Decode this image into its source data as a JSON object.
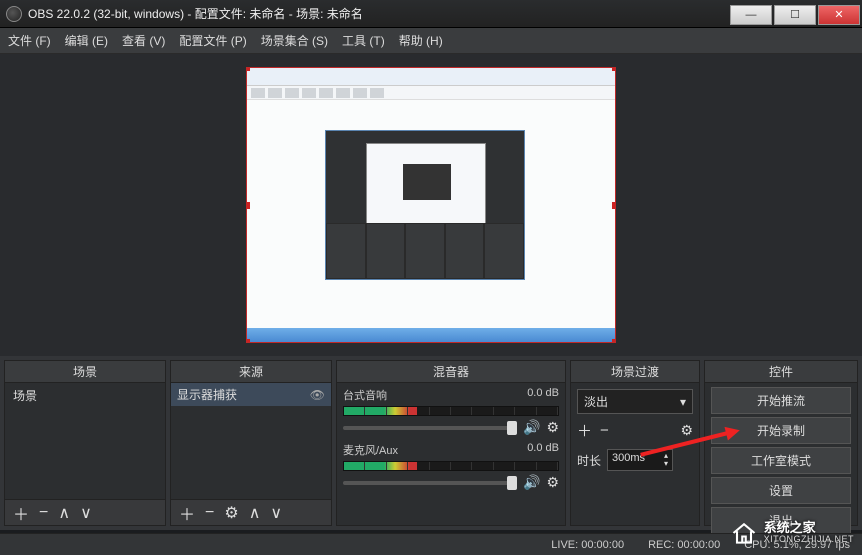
{
  "window": {
    "title": "OBS 22.0.2 (32-bit, windows) - 配置文件: 未命名 - 场景: 未命名"
  },
  "menu": {
    "file": "文件 (F)",
    "edit": "编辑 (E)",
    "view": "查看 (V)",
    "profile": "配置文件 (P)",
    "scene_collection": "场景集合 (S)",
    "tools": "工具 (T)",
    "help": "帮助 (H)"
  },
  "panels": {
    "scenes": {
      "title": "场景",
      "items": [
        "场景"
      ]
    },
    "sources": {
      "title": "来源",
      "items": [
        "显示器捕获"
      ]
    },
    "mixer": {
      "title": "混音器",
      "channels": [
        {
          "name": "台式音响",
          "level": "0.0 dB"
        },
        {
          "name": "麦克风/Aux",
          "level": "0.0 dB"
        }
      ]
    },
    "transitions": {
      "title": "场景过渡",
      "selected": "淡出",
      "duration_label": "时长",
      "duration_value": "300ms"
    },
    "controls": {
      "title": "控件",
      "buttons": {
        "start_stream": "开始推流",
        "start_record": "开始录制",
        "studio_mode": "工作室模式",
        "settings": "设置",
        "exit": "退出"
      }
    }
  },
  "statusbar": {
    "live": "LIVE: 00:00:00",
    "rec": "REC: 00:00:00",
    "cpu": "CPU: 5.1%, 29.97 fps"
  },
  "watermark": {
    "name": "系统之家",
    "url": "XITONGZHIJIA.NET"
  }
}
